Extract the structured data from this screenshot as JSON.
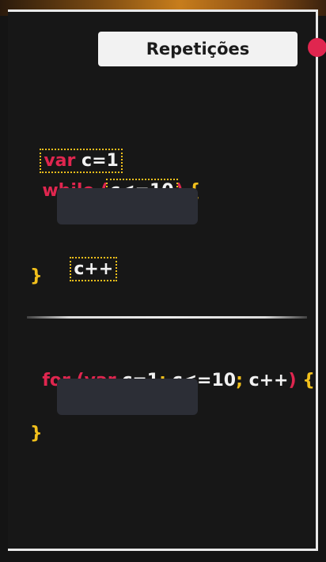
{
  "title": "Repetições",
  "while_example": {
    "line1": {
      "kw": "var",
      "rest": " c=1"
    },
    "line2": {
      "kw": "while ",
      "open_paren": "(",
      "condition": "c<=10",
      "close_paren": ")",
      "brace": "{"
    },
    "increment": "c++",
    "close_brace": "}"
  },
  "for_example": {
    "kw_for": "for ",
    "paren_open": "(",
    "kw_var": "var ",
    "init": "c=1",
    "sep1": ";",
    "cond": " c<=10",
    "sep2": ";",
    "incr": " c++",
    "paren_close": ")",
    "brace": " {",
    "close_brace": "}"
  },
  "colors": {
    "keyword": "#e0264f",
    "plain": "#f2f2f2",
    "brace": "#f2c01c",
    "highlight_outline": "#f2c01c",
    "placeholder_box": "#2c2e36",
    "accent_dot": "#e0264f"
  }
}
